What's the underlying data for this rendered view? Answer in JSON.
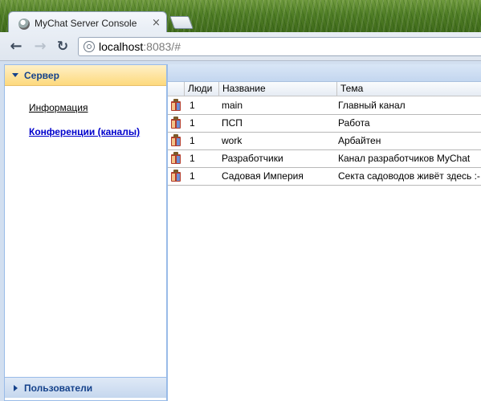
{
  "browser": {
    "tab_title": "MyChat Server Console",
    "tab_close": "×",
    "url_host": "localhost",
    "url_rest": ":8083/#"
  },
  "sidebar": {
    "active_section": "Сервер",
    "items": [
      {
        "label": "Информация",
        "active": false
      },
      {
        "label": "Конференции (каналы)",
        "active": true
      }
    ],
    "collapsed_section": "Пользователи"
  },
  "grid": {
    "columns": [
      "Люди",
      "Название",
      "Тема"
    ],
    "rows": [
      {
        "people": "1",
        "name": "main",
        "topic": "Главный канал"
      },
      {
        "people": "1",
        "name": "ПСП",
        "topic": "Работа"
      },
      {
        "people": "1",
        "name": "work",
        "topic": "Арбайтен"
      },
      {
        "people": "1",
        "name": "Разработчики",
        "topic": "Канал разработчиков MyChat"
      },
      {
        "people": "1",
        "name": "Садовая Империя",
        "topic": "Секта садоводов живёт здесь :-"
      }
    ],
    "row_icon": "channel-icon"
  },
  "colors": {
    "accent": "#15428b",
    "active_link": "#0000cc",
    "panel_border": "#99bbe8"
  }
}
